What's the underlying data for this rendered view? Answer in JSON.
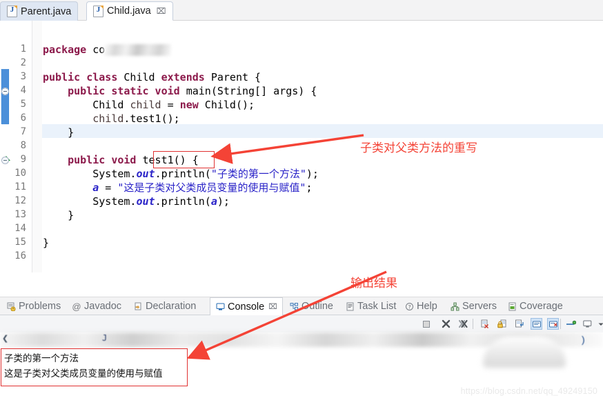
{
  "editor_tabs": [
    {
      "label": "Parent.java",
      "active": false,
      "closable": false
    },
    {
      "label": "Child.java",
      "active": true,
      "closable": true,
      "close_glyph": "⌧"
    }
  ],
  "code": {
    "lines": [
      {
        "num": "1",
        "text": "package co",
        "blurred_tail": true
      },
      {
        "num": "2",
        "text": ""
      },
      {
        "num": "3",
        "text": "public class Child extends Parent {"
      },
      {
        "num": "4",
        "text": "    public static void main(String[] args) {",
        "fold": true
      },
      {
        "num": "5",
        "text": "        Child child = new Child();"
      },
      {
        "num": "6",
        "text": "        child.test1();",
        "current": true
      },
      {
        "num": "7",
        "text": "    }"
      },
      {
        "num": "8",
        "text": ""
      },
      {
        "num": "9",
        "text": "    public void test1() {",
        "fold": true,
        "marker": "override-triangle"
      },
      {
        "num": "10",
        "text": "        System.out.println(\"子类的第一个方法\");"
      },
      {
        "num": "11",
        "text": "        a = \"这是子类对父类成员变量的使用与赋值\";"
      },
      {
        "num": "12",
        "text": "        System.out.println(a);"
      },
      {
        "num": "13",
        "text": "    }"
      },
      {
        "num": "14",
        "text": ""
      },
      {
        "num": "15",
        "text": "}"
      },
      {
        "num": "16",
        "text": ""
      }
    ]
  },
  "annotations": [
    {
      "id": "override-note",
      "text": "子类对父类方法的重写"
    },
    {
      "id": "output-note",
      "text": "输出结果"
    }
  ],
  "view_tabs": [
    {
      "label": "Problems",
      "icon": "problems-icon",
      "active": false
    },
    {
      "label": "Javadoc",
      "icon": "javadoc-icon",
      "active": false
    },
    {
      "label": "Declaration",
      "icon": "declaration-icon",
      "active": false
    },
    {
      "label": "Console",
      "icon": "console-icon",
      "active": true,
      "close_glyph": "⌧"
    },
    {
      "label": "Outline",
      "icon": "outline-icon",
      "active": false
    },
    {
      "label": "Task List",
      "icon": "tasklist-icon",
      "active": false
    },
    {
      "label": "Help",
      "icon": "help-icon",
      "active": false
    },
    {
      "label": "Servers",
      "icon": "servers-icon",
      "active": false
    },
    {
      "label": "Coverage",
      "icon": "coverage-icon",
      "active": false
    }
  ],
  "console_toolbar": [
    {
      "icon": "terminate-icon",
      "glyph": "■",
      "selected": false
    },
    {
      "icon": "remove-launch-icon",
      "glyph": "✖",
      "selected": false
    },
    {
      "icon": "remove-all-icon",
      "glyph": "✖",
      "selected": false
    },
    {
      "icon": "clear-console-icon",
      "glyph": "⎘",
      "selected": false
    },
    {
      "icon": "scroll-lock-icon",
      "glyph": "⚿",
      "selected": false
    },
    {
      "icon": "word-wrap-icon",
      "glyph": "↵",
      "selected": false
    },
    {
      "icon": "show-console-icon",
      "glyph": "☰",
      "selected": true
    },
    {
      "icon": "stderr-console-icon",
      "glyph": "☰",
      "selected": true
    },
    {
      "icon": "pin-console-icon",
      "glyph": "─",
      "selected": false
    },
    {
      "icon": "display-console-icon",
      "glyph": "⌨",
      "selected": false
    },
    {
      "icon": "view-menu-icon",
      "glyph": "▾",
      "selected": false
    }
  ],
  "console_output": {
    "lines": [
      "子类的第一个方法",
      "这是子类对父类成员变量的使用与赋值"
    ]
  },
  "watermark": "https://blog.csdn.net/qq_49249150",
  "colors": {
    "annotation_red": "#f44336",
    "redbox": "#e03131",
    "keyword": "#8c1a4b",
    "string": "#2a23c8",
    "current_line": "#eaf2fb",
    "tab_inactive": "#dfe7f3"
  }
}
